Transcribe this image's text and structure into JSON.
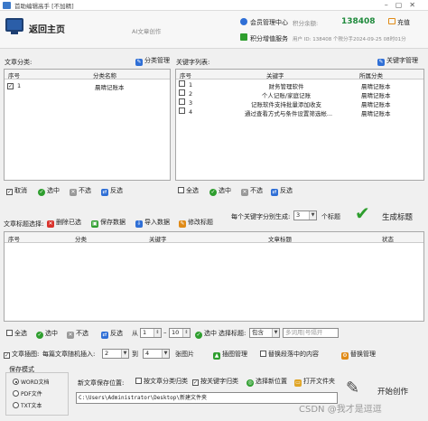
{
  "window": {
    "title": "首助编辑高手 [不加精]"
  },
  "header": {
    "home_label": "返回主页",
    "subtitle": "AI文章创作",
    "member_center": "会员管理中心",
    "points_label": "积分余额:",
    "points_value": "138408",
    "recharge": "充值",
    "points_service": "积分增值服务",
    "account_info": "用户 ID: 138408 个税分手2024-09-25 08时01分"
  },
  "category_panel": {
    "title": "文章分类:",
    "manage": "分类管理",
    "columns": [
      "序号",
      "分类名称"
    ],
    "rows": [
      {
        "no": "1",
        "name": "晨晴记账本",
        "checked": true
      }
    ],
    "actions": {
      "cancel": "取消",
      "select": "选中",
      "deselect": "不选",
      "invert": "反选"
    }
  },
  "keyword_panel": {
    "title": "关键字列表:",
    "manage": "关键字管理",
    "columns": [
      "序号",
      "关键字",
      "所属分类"
    ],
    "rows": [
      {
        "no": "1",
        "keyword": "财务管理软件",
        "category": "晨晴记账本"
      },
      {
        "no": "2",
        "keyword": "个人记账/家庭记账",
        "category": "晨晴记账本"
      },
      {
        "no": "3",
        "keyword": "记账软件支持批量添加收支",
        "category": "晨晴记账本"
      },
      {
        "no": "4",
        "keyword": "通过查看方式与条件设置筛选帐...",
        "category": "晨晴记账本"
      }
    ],
    "actions": {
      "all": "全选",
      "select": "选中",
      "deselect": "不选",
      "invert": "反选"
    }
  },
  "generation": {
    "per_keyword_label": "每个关键字分别生成:",
    "per_keyword_value": "3",
    "unit": "个标题",
    "generate": "生成标题"
  },
  "title_toolbar": {
    "label": "文章标题选择:",
    "delete": "删除已选",
    "save": "保存数据",
    "import": "导入数据",
    "edit": "修改标题"
  },
  "title_table": {
    "columns": [
      "序号",
      "分类",
      "关键字",
      "文章标题",
      "状态"
    ],
    "rows": []
  },
  "title_actions": {
    "all": "全选",
    "select": "选中",
    "deselect": "不选",
    "invert": "反选",
    "from_label": "从",
    "from": "1",
    "to": "10",
    "select_btn": "选中",
    "filter_label": "选择标题:",
    "filter_mode": "包含",
    "filter_placeholder": "多词用|号隔开"
  },
  "image_options": {
    "insert_label": "文章插图:",
    "random_label": "每篇文章随机插入:",
    "min": "2",
    "to": "到",
    "max": "4",
    "unit": "张图片",
    "manage": "插图管理",
    "replace_label": "替换段落中的内容",
    "replace_manage": "替换管理"
  },
  "save_mode": {
    "title": "保存模式",
    "options": [
      {
        "label": "WORD文档",
        "selected": true
      },
      {
        "label": "PDF文件",
        "selected": false
      },
      {
        "label": "TXT文本",
        "selected": false
      }
    ],
    "location_label": "新文章保存位置:",
    "by_category": "按文章分类归类",
    "by_keyword": "按关键字归类",
    "choose": "选择新位置",
    "open": "打开文件夹",
    "path": "C:\\Users\\Administrator\\Desktop\\新建文件夹",
    "start": "开始创作"
  },
  "watermark": "CSDN @我才是逗逗",
  "colors": {
    "green": "#2e9e2e",
    "red": "#d9322b",
    "blue": "#2f6fd6",
    "orange": "#e08a16",
    "points": "#1f8a3c"
  }
}
